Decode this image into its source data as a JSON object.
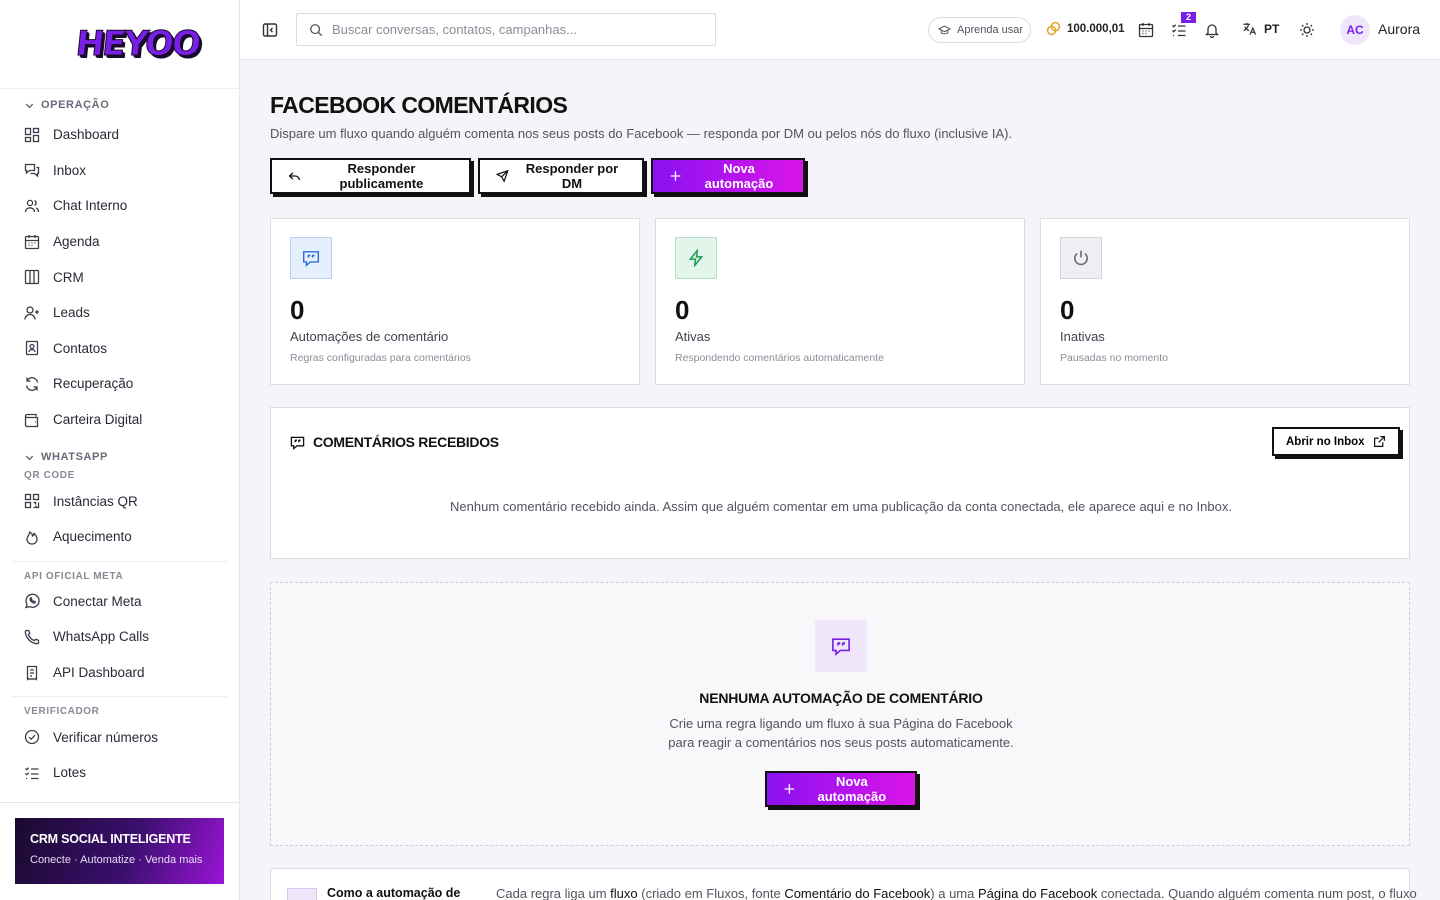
{
  "brand": {
    "logo_text": "HEYOO"
  },
  "sidebar": {
    "sections": [
      {
        "title": "OPERAÇÃO",
        "items": [
          "Dashboard",
          "Inbox",
          "Chat Interno",
          "Agenda",
          "CRM",
          "Leads",
          "Contatos",
          "Recuperação",
          "Carteira Digital"
        ]
      },
      {
        "title": "WHATSAPP",
        "sub": "QR CODE",
        "items": [
          "Instâncias QR",
          "Aquecimento"
        ]
      },
      {
        "sub": "API OFICIAL META",
        "items": [
          "Conectar Meta",
          "WhatsApp Calls",
          "API Dashboard"
        ]
      },
      {
        "sub": "VERIFICADOR",
        "items": [
          "Verificar números",
          "Lotes"
        ]
      }
    ],
    "promo": {
      "title": "CRM SOCIAL INTELIGENTE",
      "subtitle": "Conecte · Automatize · Venda mais"
    }
  },
  "topbar": {
    "search_placeholder": "Buscar conversas, contatos, campanhas...",
    "learn_label": "Aprenda usar",
    "coins": "100.000,01",
    "tasks_badge": "2",
    "language": "PT",
    "avatar_initials": "AC",
    "username": "Aurora"
  },
  "page": {
    "title": "FACEBOOK COMENTÁRIOS",
    "subtitle": "Dispare um fluxo quando alguém comenta nos seus posts do Facebook — responda por DM ou pelos nós do fluxo (inclusive IA).",
    "buttons": {
      "reply_public": "Responder publicamente",
      "reply_dm": "Responder por DM",
      "new_automation": "Nova automação"
    }
  },
  "stats": [
    {
      "value": "0",
      "label": "Automações de comentário",
      "desc": "Regras configuradas para comentários",
      "icon": "message-quote-icon",
      "color": "#2f6fd8"
    },
    {
      "value": "0",
      "label": "Ativas",
      "desc": "Respondendo comentários automaticamente",
      "icon": "bolt-icon",
      "color": "#1f9d55"
    },
    {
      "value": "0",
      "label": "Inativas",
      "desc": "Pausadas no momento",
      "icon": "power-icon",
      "color": "#6b6878"
    }
  ],
  "comments": {
    "title": "COMENTÁRIOS RECEBIDOS",
    "open_inbox": "Abrir no Inbox",
    "empty": "Nenhum comentário recebido ainda. Assim que alguém comentar em uma publicação da conta conectada, ele aparece aqui e no Inbox."
  },
  "empty_state": {
    "title": "NENHUMA AUTOMAÇÃO DE COMENTÁRIO",
    "line1": "Crie uma regra ligando um fluxo à sua Página do Facebook",
    "line2": "para reagir a comentários nos seus posts automaticamente.",
    "button": "Nova automação"
  },
  "info": {
    "title": "Como a automação de",
    "text_1": "Cada regra liga um ",
    "kw_1": "fluxo",
    "text_2": " (criado em Fluxos, fonte ",
    "kw_2": "Comentário do Facebook",
    "text_3": ") a uma ",
    "kw_3": "Página do Facebook",
    "text_4": " conectada. Quando alguém comenta num post, o fluxo"
  },
  "colors": {
    "accent": "#7a1fe6",
    "accent_gradient_end": "#d915e8",
    "ink": "#111111"
  }
}
